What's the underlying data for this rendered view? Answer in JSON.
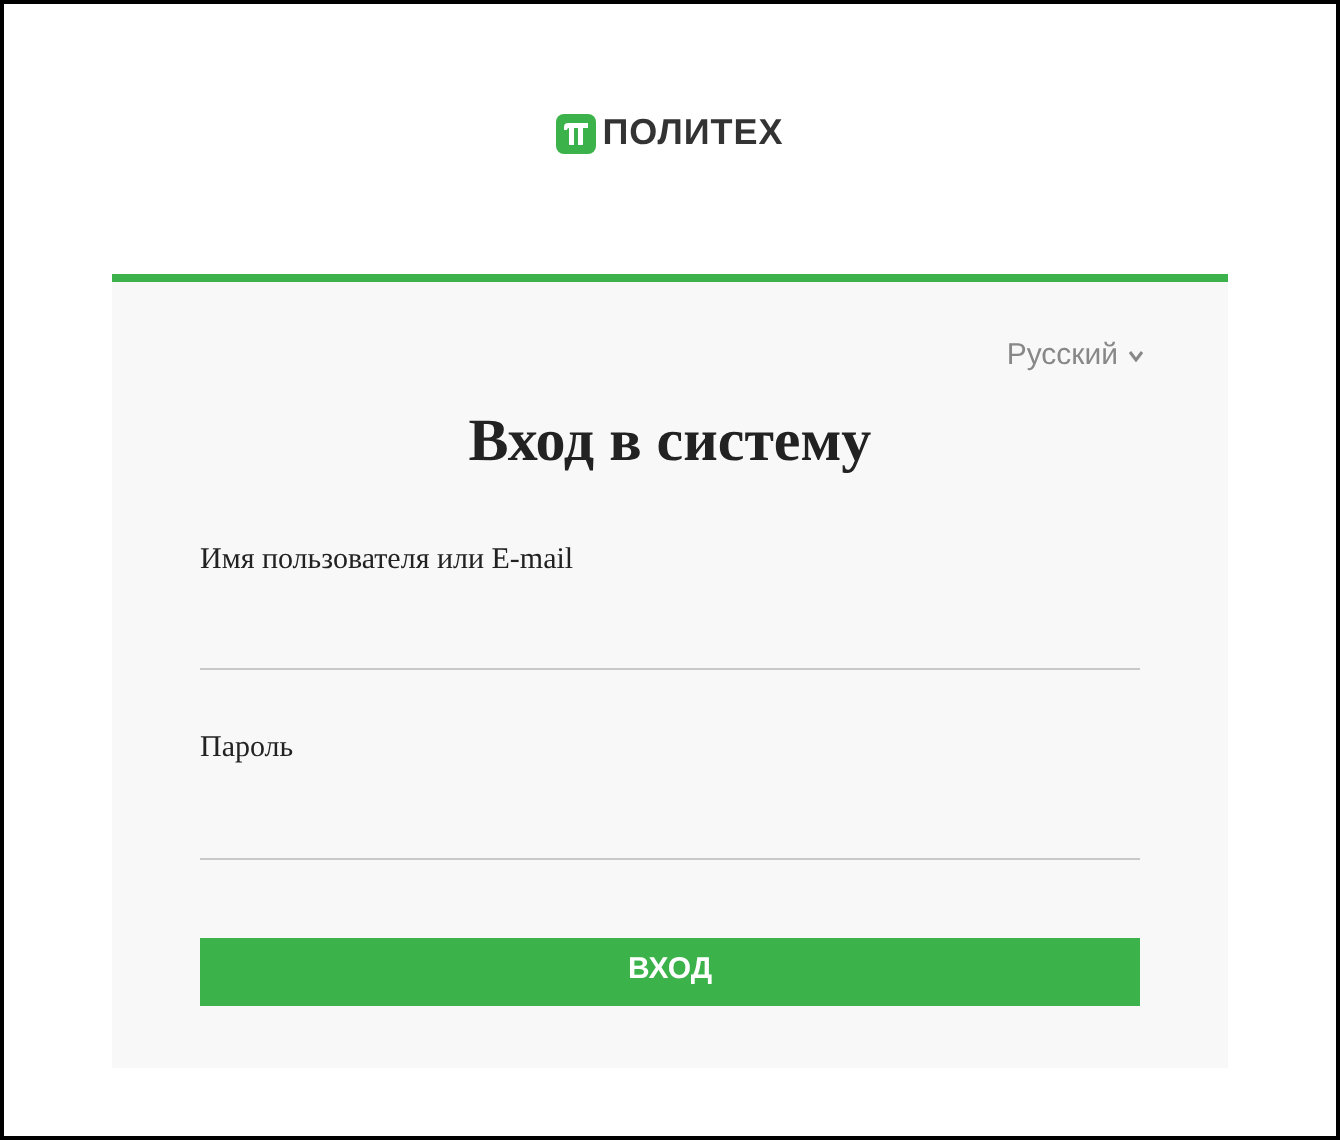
{
  "logo": {
    "text": "ПОЛИТЕХ"
  },
  "language": {
    "label": "Русский"
  },
  "title": "Вход в систему",
  "fields": [
    {
      "label": "Имя пользователя или E-mail"
    },
    {
      "label": "Пароль"
    }
  ],
  "submit": "ВХОД"
}
